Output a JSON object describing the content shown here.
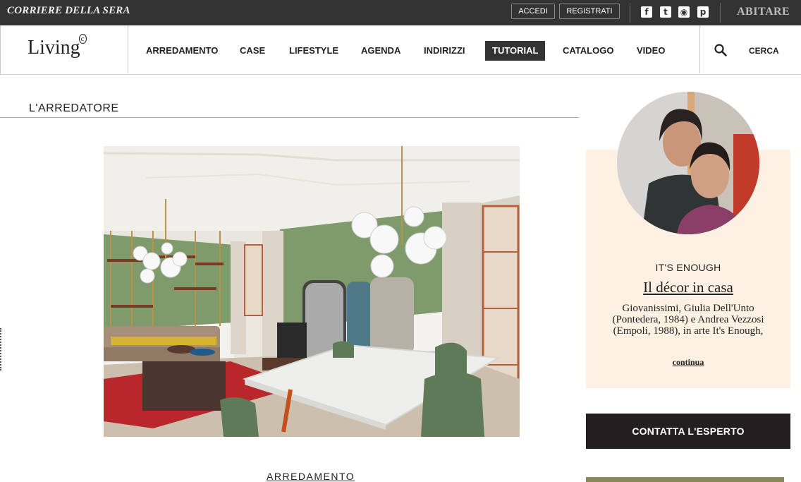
{
  "topbar": {
    "brand": "CORRIERE DELLA SERA",
    "login_label": "ACCEDI",
    "register_label": "REGISTRATI",
    "social": [
      "facebook-icon",
      "twitter-icon",
      "rss-icon",
      "pinterest-icon"
    ],
    "sister_brand": "ABITARE"
  },
  "nav": {
    "logo": "Living",
    "items": [
      "ARREDAMENTO",
      "CASE",
      "LIFESTYLE",
      "AGENDA",
      "INDIRIZZI",
      "TUTORIAL",
      "CATALOGO",
      "VIDEO"
    ],
    "active": "TUTORIAL",
    "search_label": "CERCA"
  },
  "section": {
    "title": "L'ARREDATORE"
  },
  "article": {
    "category": "ARREDAMENTO"
  },
  "expert": {
    "name": "IT'S ENOUGH",
    "title": "Il décor in casa",
    "description": "Giovanissimi, Giulia Dell'Unto (Pontedera, 1984) e Andrea Vezzosi (Empoli, 1988), in arte It's Enough,",
    "more_label": "continua",
    "contact_label": "CONTATTA L'ESPERTO"
  },
  "colors": {
    "topbar": "#333333",
    "active_nav": "#333333",
    "card_bg": "#fdf1e4",
    "contact_bg": "#231f20",
    "wall_green": "#7f9a6b"
  }
}
